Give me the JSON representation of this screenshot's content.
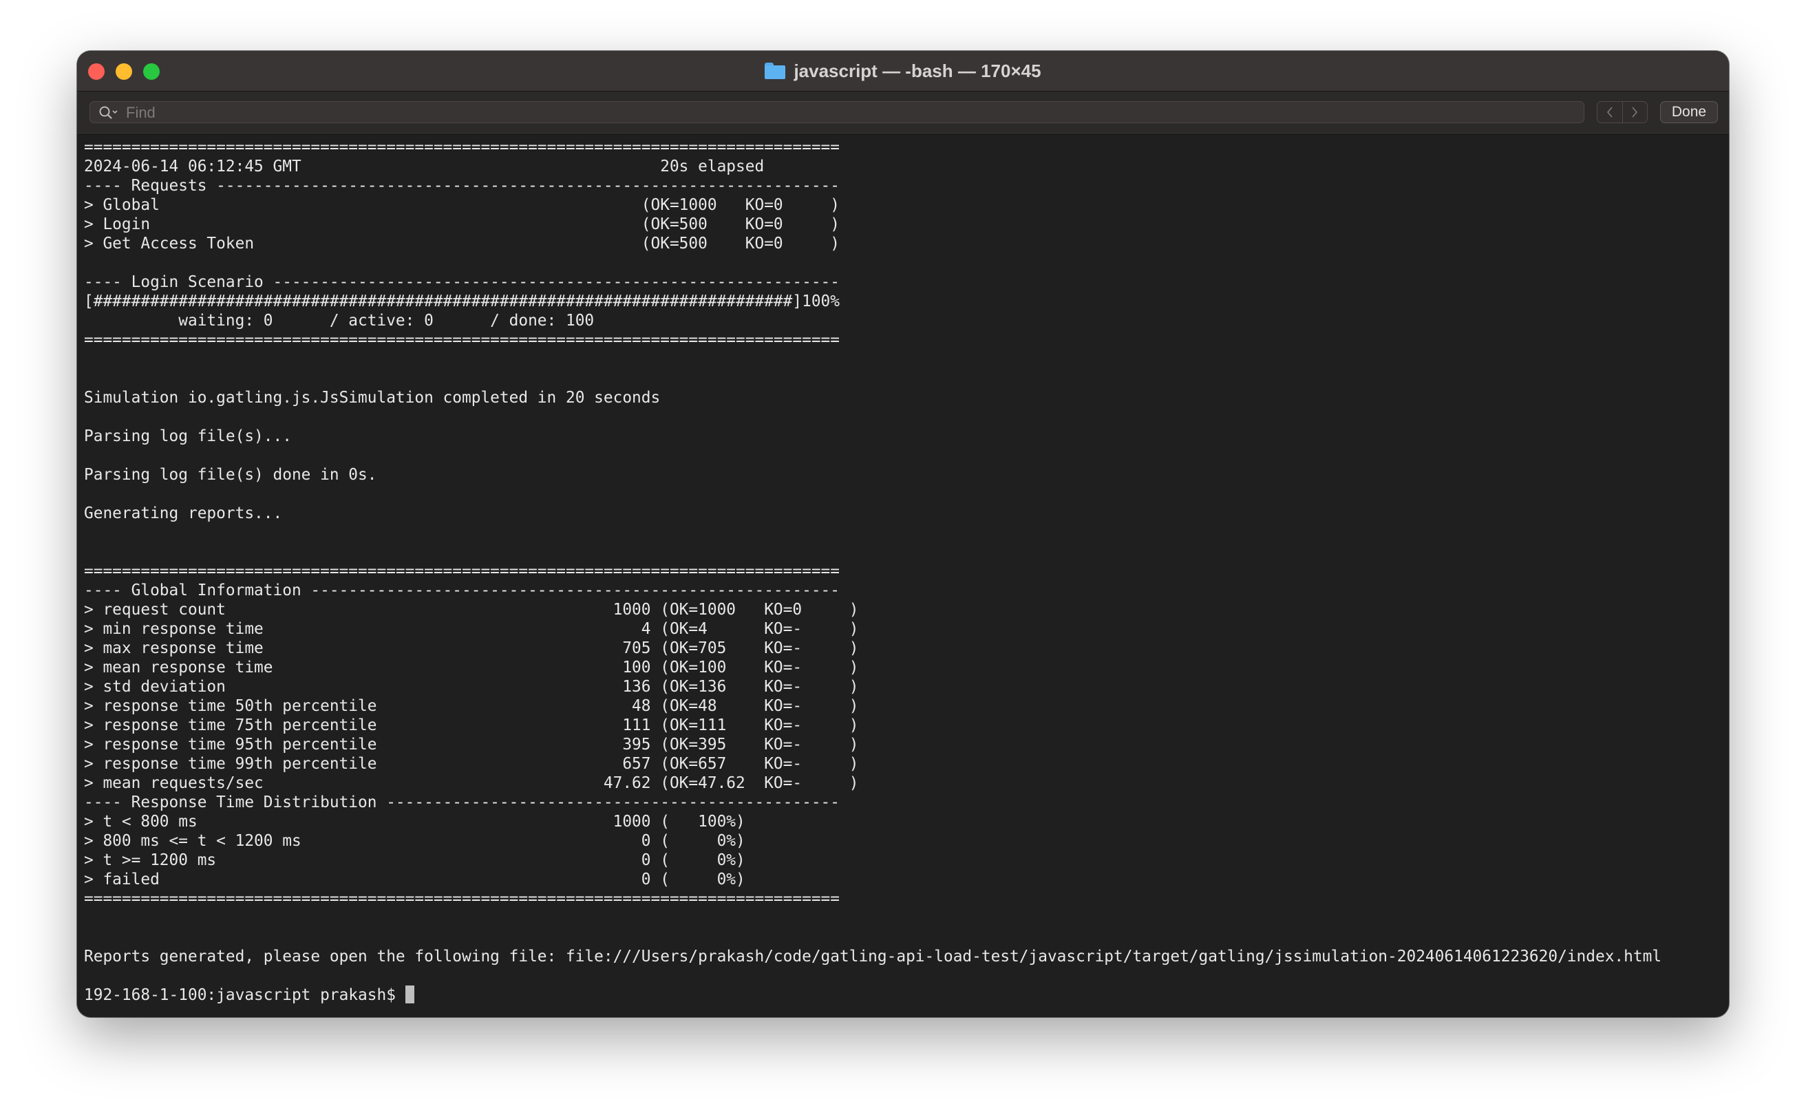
{
  "window": {
    "title": "javascript — -bash — 170×45",
    "title_icon": "folder-icon"
  },
  "findbar": {
    "placeholder": "Find",
    "done_label": "Done"
  },
  "terminal": {
    "lines": [
      "================================================================================",
      "2024-06-14 06:12:45 GMT                                      20s elapsed",
      "---- Requests ------------------------------------------------------------------",
      "> Global                                                   (OK=1000   KO=0     )",
      "> Login                                                    (OK=500    KO=0     )",
      "> Get Access Token                                         (OK=500    KO=0     )",
      "",
      "---- Login Scenario ------------------------------------------------------------",
      "[##########################################################################]100%",
      "          waiting: 0      / active: 0      / done: 100",
      "================================================================================",
      "",
      "",
      "Simulation io.gatling.js.JsSimulation completed in 20 seconds",
      "",
      "Parsing log file(s)...",
      "",
      "Parsing log file(s) done in 0s.",
      "",
      "Generating reports...",
      "",
      "",
      "================================================================================",
      "---- Global Information --------------------------------------------------------",
      "> request count                                         1000 (OK=1000   KO=0     )",
      "> min response time                                        4 (OK=4      KO=-     )",
      "> max response time                                      705 (OK=705    KO=-     )",
      "> mean response time                                     100 (OK=100    KO=-     )",
      "> std deviation                                          136 (OK=136    KO=-     )",
      "> response time 50th percentile                           48 (OK=48     KO=-     )",
      "> response time 75th percentile                          111 (OK=111    KO=-     )",
      "> response time 95th percentile                          395 (OK=395    KO=-     )",
      "> response time 99th percentile                          657 (OK=657    KO=-     )",
      "> mean requests/sec                                    47.62 (OK=47.62  KO=-     )",
      "---- Response Time Distribution ------------------------------------------------",
      "> t < 800 ms                                            1000 (   100%)",
      "> 800 ms <= t < 1200 ms                                    0 (     0%)",
      "> t >= 1200 ms                                             0 (     0%)",
      "> failed                                                   0 (     0%)",
      "================================================================================",
      "",
      "",
      "Reports generated, please open the following file: file:///Users/prakash/code/gatling-api-load-test/javascript/target/gatling/jssimulation-20240614061223620/index.html",
      ""
    ],
    "prompt": "192-168-1-100:javascript prakash$ "
  }
}
